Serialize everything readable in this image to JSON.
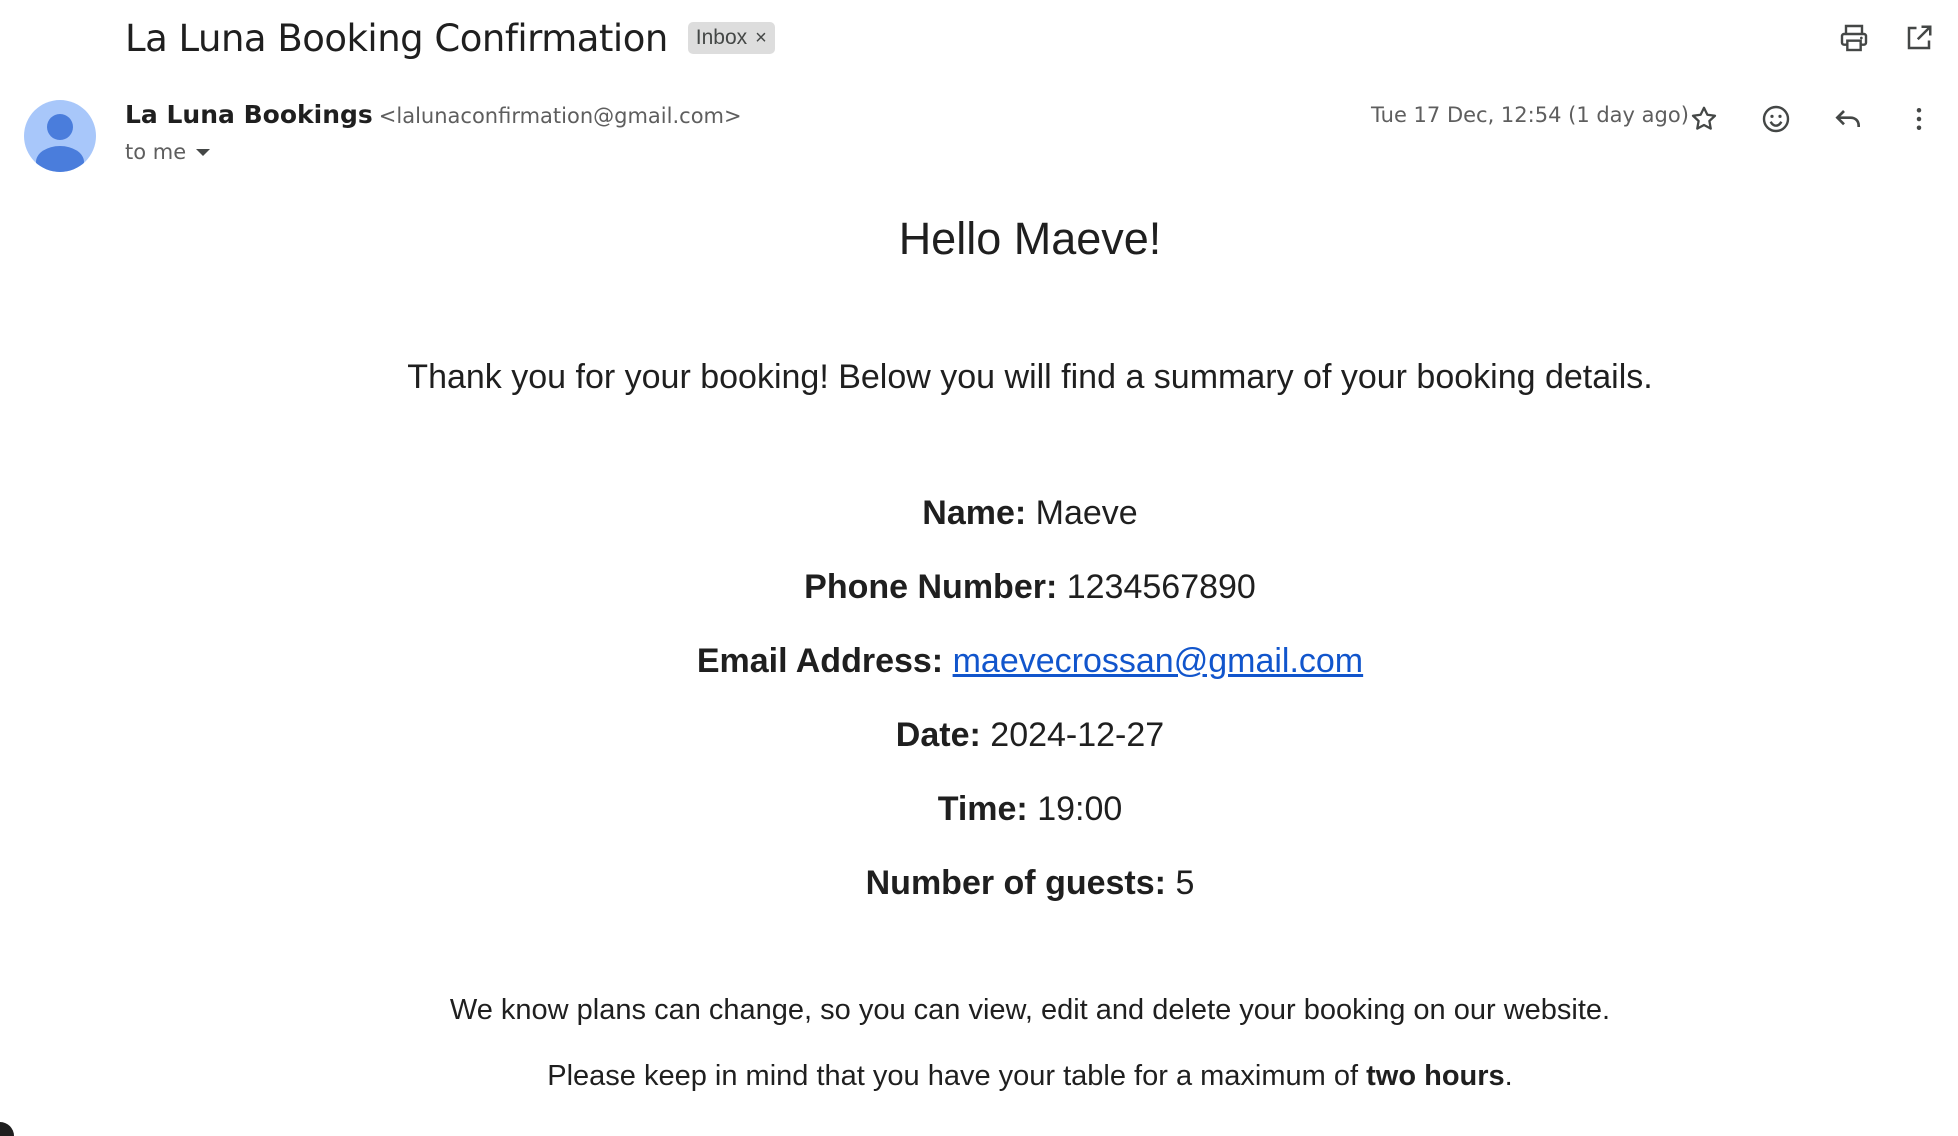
{
  "email": {
    "subject": "La Luna Booking Confirmation",
    "label_chip": "Inbox",
    "label_chip_remove": "×",
    "sender_name": "La Luna Bookings",
    "sender_email": "<lalunaconfirmation@gmail.com>",
    "recipient": "to me",
    "timestamp": "Tue 17 Dec, 12:54 (1 day ago)"
  },
  "toolbar": {
    "icons": [
      "print-icon",
      "open-in-new-window-icon",
      "star-icon",
      "emoji-react-icon",
      "reply-icon",
      "more-options-icon"
    ]
  },
  "body": {
    "greeting": "Hello Maeve!",
    "intro": "Thank you for your booking! Below you will find a summary of your booking details.",
    "details": [
      {
        "label": "Name:",
        "value": "Maeve"
      },
      {
        "label": "Phone Number:",
        "value": "1234567890"
      },
      {
        "label": "Email Address:",
        "value": "maevecrossan@gmail.com"
      },
      {
        "label": "Date:",
        "value": "2024-12-27"
      },
      {
        "label": "Time:",
        "value": "19:00"
      },
      {
        "label": "Number of guests:",
        "value": "5"
      }
    ],
    "note_1": "We know plans can change, so you can view, edit and delete your booking on our website.",
    "note_2_prefix": "Please keep in mind that you have your table for a maximum of ",
    "note_2_bold": "two hours",
    "note_2_suffix": "."
  },
  "colors": {
    "avatar_bg": "#a8c7fa",
    "avatar_fg": "#4a7ddc",
    "link": "#1155cc",
    "chip_bg": "#dddddd"
  }
}
